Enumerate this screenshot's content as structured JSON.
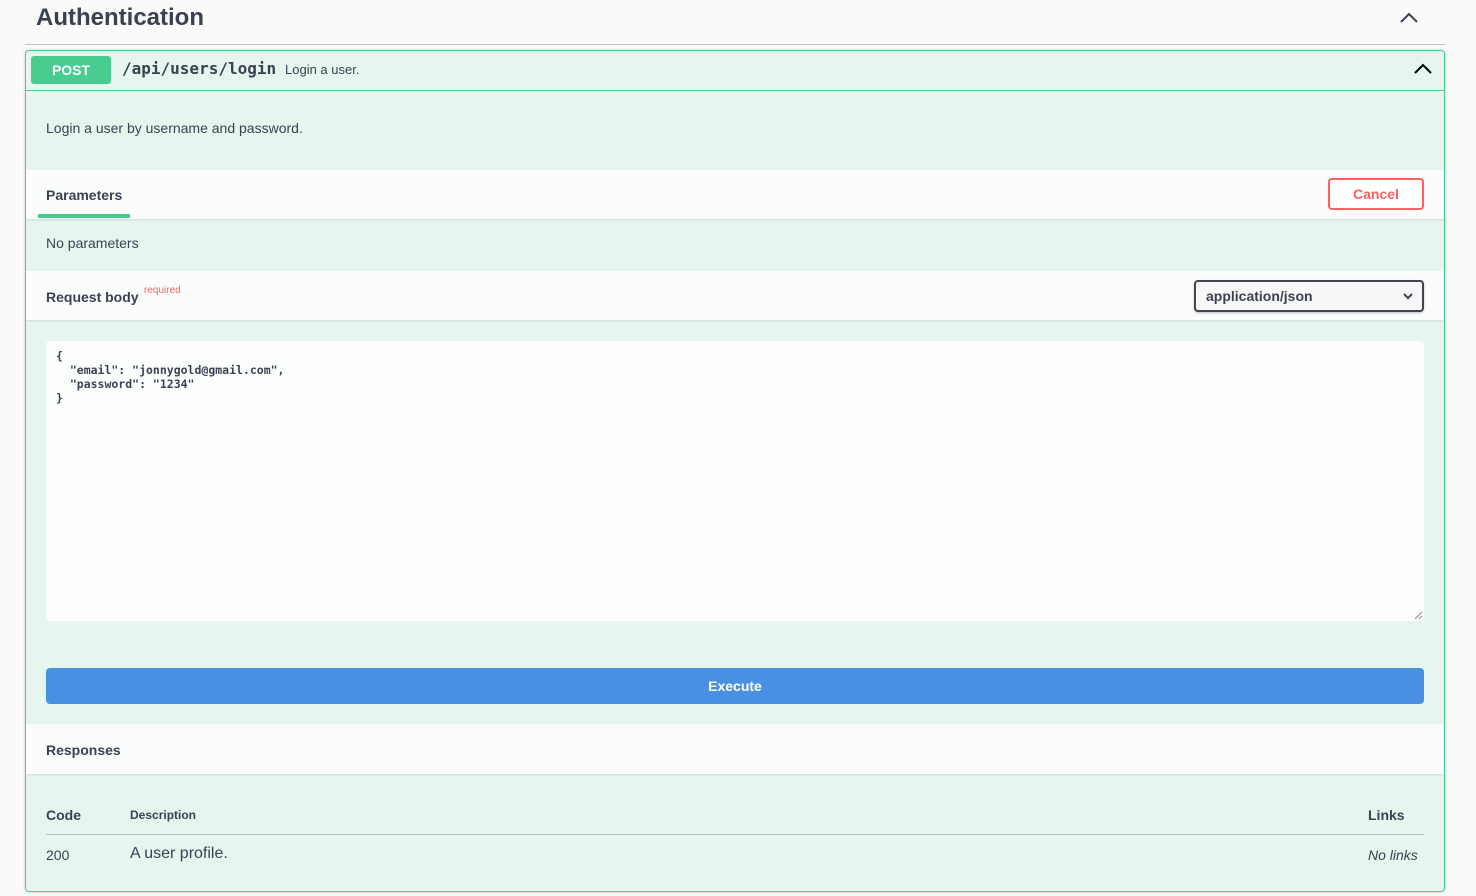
{
  "section": {
    "title": "Authentication",
    "collapse_icon": "chevron-up-icon"
  },
  "operation": {
    "method": "POST",
    "path": "/api/users/login",
    "summary": "Login a user.",
    "description": "Login a user by username and password.",
    "collapse_icon": "chevron-up-icon",
    "colors": {
      "method": "#49cc90",
      "border": "#49cc90"
    }
  },
  "parameters": {
    "tab_label": "Parameters",
    "cancel_label": "Cancel",
    "empty_text": "No parameters"
  },
  "request_body": {
    "label": "Request body",
    "required_label": "required",
    "content_type": "application/json",
    "dropdown_icon": "chevron-down-icon",
    "body": "{\n  \"email\": \"jonnygold@gmail.com\",\n  \"password\": \"1234\"\n}"
  },
  "execute": {
    "label": "Execute",
    "color": "#4990e2"
  },
  "responses": {
    "title": "Responses",
    "columns": {
      "code": "Code",
      "description": "Description",
      "links": "Links"
    },
    "rows": [
      {
        "code": "200",
        "description": "A user profile.",
        "links": "No links"
      }
    ]
  }
}
